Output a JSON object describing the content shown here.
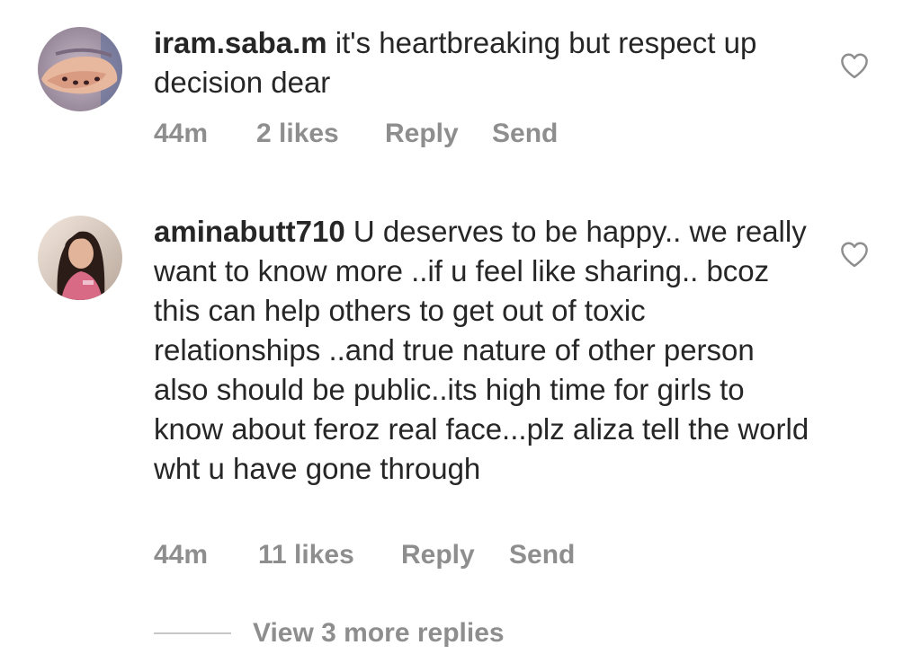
{
  "comments": [
    {
      "username": "iram.saba.m",
      "text": " it's heartbreaking but respect up decision dear",
      "time": "44m",
      "likes": "2 likes",
      "reply_label": "Reply",
      "send_label": "Send",
      "avatar_icon": "hands-photo-avatar",
      "like_icon": "heart-outline-icon"
    },
    {
      "username": "aminabutt710",
      "text": " U deserves to be happy.. we really want to know more ..if u feel like sharing.. bcoz this can help others to get out of toxic  relationships ..and true nature of other person also should be public..its high time for girls to know about feroz real face...plz aliza tell the world wht u have gone through",
      "time": "44m",
      "likes": "11 likes",
      "reply_label": "Reply",
      "send_label": "Send",
      "avatar_icon": "woman-photo-avatar",
      "like_icon": "heart-outline-icon"
    }
  ],
  "view_more": {
    "label": "View 3 more replies"
  },
  "colors": {
    "text": "#262626",
    "secondary": "#8e8e8e",
    "divider": "#c7c7c7"
  }
}
